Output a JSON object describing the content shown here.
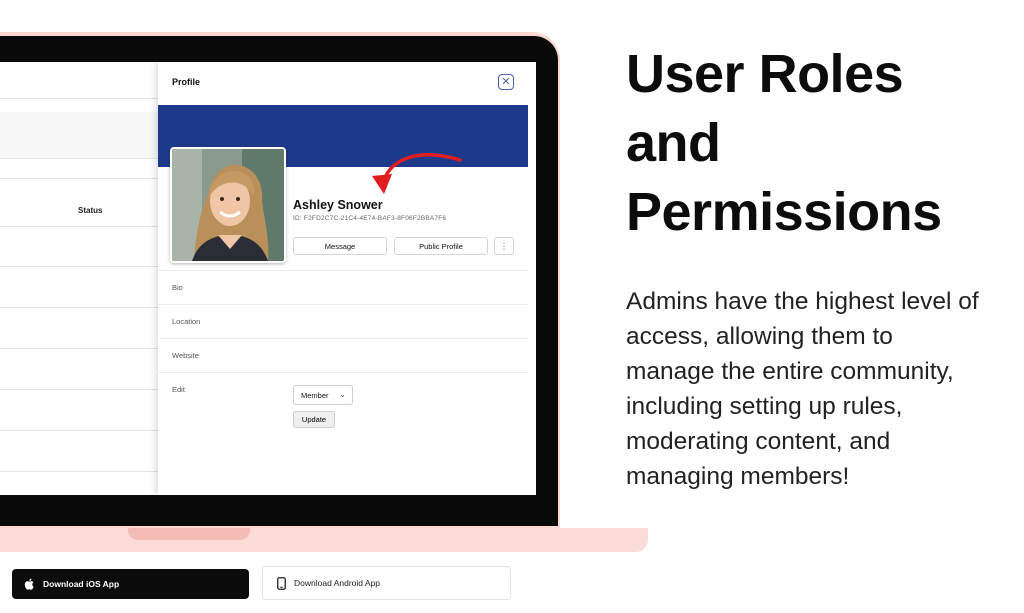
{
  "profile_panel": {
    "title": "Profile",
    "user_name": "Ashley Snower",
    "user_id": "ID: F2FD2C7C-21C4-4E74-BAF3-8F06F2BBA7F6",
    "message_label": "Message",
    "public_profile_label": "Public Profile",
    "more_label": "⋮",
    "close_label": "✕",
    "fields": {
      "bio": "Bio",
      "location": "Location",
      "website": "Website",
      "edit": "Edit"
    },
    "role_select_value": "Member",
    "update_label": "Update",
    "cover_color": "#1d3a8a"
  },
  "background_table": {
    "status_header": "Status"
  },
  "headline": {
    "line1": "User Roles",
    "line2": "and",
    "line3": "Permissions"
  },
  "description": "Admins have the highest level of access, allowing them to manage the entire community, including setting up rules, moderating content, and managing members!",
  "downloads": {
    "ios_label": "Download iOS App",
    "android_label": "Download Android App",
    "ios_icon": "apple-icon",
    "android_icon": "phone-icon"
  },
  "colors": {
    "laptop": "#fad8d2",
    "arrow": "#e11d1d"
  }
}
